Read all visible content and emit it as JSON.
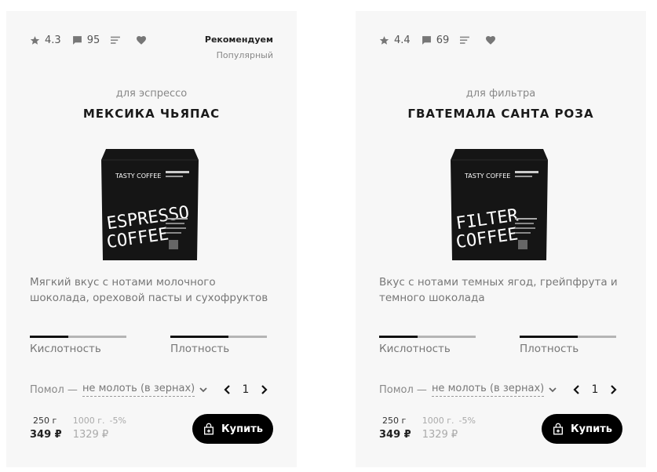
{
  "products": [
    {
      "rating": "4.3",
      "comments": "95",
      "tag_primary": "Рекомендуем",
      "tag_secondary": "Популярный",
      "kind": "для эспрессо",
      "title": "МЕКСИКА ЧЬЯПАС",
      "bag_text": [
        "ESPRESSO",
        "COFFEE"
      ],
      "bag_brand": "TASTY COFFEE",
      "description": "Мягкий вкус с нотами молочного шоколада, ореховой пасты и сухофруктов",
      "acidity_label": "Кислотность",
      "acidity_level": 0.4,
      "density_label": "Плотность",
      "density_level": 0.6,
      "grind_label": "Помол —",
      "grind_value": "не молоть (в зернах)",
      "quantity": "1",
      "weight_small": "250 г",
      "price_small": "349 ₽",
      "weight_large": "1000 г.",
      "discount": "-5%",
      "price_large": "1329 ₽",
      "buy_label": "Купить"
    },
    {
      "rating": "4.4",
      "comments": "69",
      "tag_primary": "",
      "tag_secondary": "",
      "kind": "для фильтра",
      "title": "ГВАТЕМАЛА САНТА РОЗА",
      "bag_text": [
        "FILTER",
        "COFFEE"
      ],
      "bag_brand": "TASTY COFFEE",
      "description": "Вкус с нотами темных ягод, грейпфрута и темного шоколада",
      "acidity_label": "Кислотность",
      "acidity_level": 0.4,
      "density_label": "Плотность",
      "density_level": 0.6,
      "grind_label": "Помол —",
      "grind_value": "не молоть (в зернах)",
      "quantity": "1",
      "weight_small": "250 г",
      "price_small": "349 ₽",
      "weight_large": "1000 г.",
      "discount": "-5%",
      "price_large": "1329 ₽",
      "buy_label": "Купить"
    }
  ],
  "icons": {
    "rating": "star-icon",
    "comments": "comment-icon",
    "details": "list-icon",
    "favorite": "heart-icon",
    "grind_dropdown": "chevron-down-icon",
    "qty_decrease": "chevron-left-icon",
    "qty_increase": "chevron-right-icon",
    "buy": "shopping-bag-icon"
  },
  "colors": {
    "card_bg": "#f7f7f7",
    "button_bg": "#000000",
    "bar_fill": "#111111",
    "bar_track": "#b5b5b5"
  }
}
